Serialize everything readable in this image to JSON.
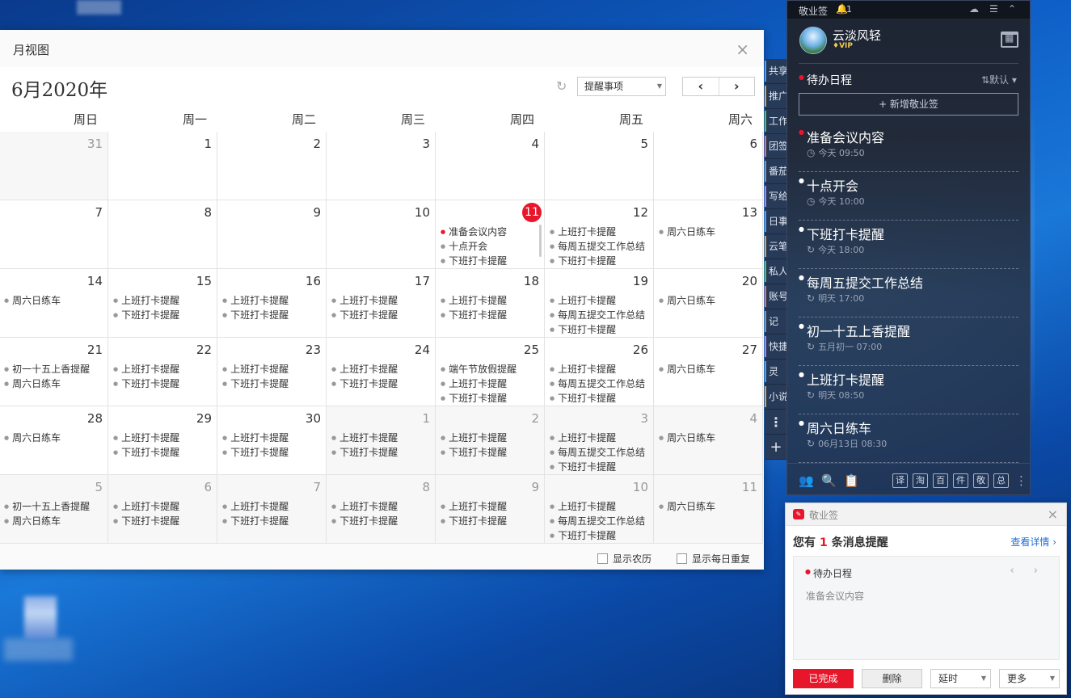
{
  "month_view": {
    "title": "月视图",
    "close_icon": "×",
    "month_label": "6月2020年",
    "refresh_icon": "↻",
    "filter_value": "提醒事项",
    "prev_icon": "‹",
    "next_icon": "›",
    "weekdays": [
      "周日",
      "周一",
      "周二",
      "周三",
      "周四",
      "周五",
      "周六"
    ],
    "weeks": [
      [
        {
          "day": "31",
          "other": true,
          "events": []
        },
        {
          "day": "1",
          "events": []
        },
        {
          "day": "2",
          "events": []
        },
        {
          "day": "3",
          "events": []
        },
        {
          "day": "4",
          "events": []
        },
        {
          "day": "5",
          "events": []
        },
        {
          "day": "6",
          "events": []
        }
      ],
      [
        {
          "day": "7",
          "events": []
        },
        {
          "day": "8",
          "events": []
        },
        {
          "day": "9",
          "events": []
        },
        {
          "day": "10",
          "events": []
        },
        {
          "day": "11",
          "today": true,
          "events": [
            "准备会议内容",
            "十点开会",
            "下班打卡提醒"
          ]
        },
        {
          "day": "12",
          "events": [
            "上班打卡提醒",
            "每周五提交工作总结",
            "下班打卡提醒"
          ]
        },
        {
          "day": "13",
          "events": [
            "周六日练车"
          ]
        }
      ],
      [
        {
          "day": "14",
          "events": [
            "周六日练车"
          ]
        },
        {
          "day": "15",
          "events": [
            "上班打卡提醒",
            "下班打卡提醒"
          ]
        },
        {
          "day": "16",
          "events": [
            "上班打卡提醒",
            "下班打卡提醒"
          ]
        },
        {
          "day": "17",
          "events": [
            "上班打卡提醒",
            "下班打卡提醒"
          ]
        },
        {
          "day": "18",
          "events": [
            "上班打卡提醒",
            "下班打卡提醒"
          ]
        },
        {
          "day": "19",
          "events": [
            "上班打卡提醒",
            "每周五提交工作总结",
            "下班打卡提醒"
          ]
        },
        {
          "day": "20",
          "events": [
            "周六日练车"
          ]
        }
      ],
      [
        {
          "day": "21",
          "events": [
            "初一十五上香提醒",
            "周六日练车"
          ]
        },
        {
          "day": "22",
          "events": [
            "上班打卡提醒",
            "下班打卡提醒"
          ]
        },
        {
          "day": "23",
          "events": [
            "上班打卡提醒",
            "下班打卡提醒"
          ]
        },
        {
          "day": "24",
          "events": [
            "上班打卡提醒",
            "下班打卡提醒"
          ]
        },
        {
          "day": "25",
          "events": [
            "端午节放假提醒",
            "上班打卡提醒",
            "下班打卡提醒"
          ]
        },
        {
          "day": "26",
          "events": [
            "上班打卡提醒",
            "每周五提交工作总结",
            "下班打卡提醒"
          ]
        },
        {
          "day": "27",
          "events": [
            "周六日练车"
          ]
        }
      ],
      [
        {
          "day": "28",
          "events": [
            "周六日练车"
          ]
        },
        {
          "day": "29",
          "events": [
            "上班打卡提醒",
            "下班打卡提醒"
          ]
        },
        {
          "day": "30",
          "events": [
            "上班打卡提醒",
            "下班打卡提醒"
          ]
        },
        {
          "day": "1",
          "other": true,
          "events": [
            "上班打卡提醒",
            "下班打卡提醒"
          ]
        },
        {
          "day": "2",
          "other": true,
          "events": [
            "上班打卡提醒",
            "下班打卡提醒"
          ]
        },
        {
          "day": "3",
          "other": true,
          "events": [
            "上班打卡提醒",
            "每周五提交工作总结",
            "下班打卡提醒"
          ]
        },
        {
          "day": "4",
          "other": true,
          "events": [
            "周六日练车"
          ]
        }
      ],
      [
        {
          "day": "5",
          "other": true,
          "events": [
            "初一十五上香提醒",
            "周六日练车"
          ]
        },
        {
          "day": "6",
          "other": true,
          "events": [
            "上班打卡提醒",
            "下班打卡提醒"
          ]
        },
        {
          "day": "7",
          "other": true,
          "events": [
            "上班打卡提醒",
            "下班打卡提醒"
          ]
        },
        {
          "day": "8",
          "other": true,
          "events": [
            "上班打卡提醒",
            "下班打卡提醒"
          ]
        },
        {
          "day": "9",
          "other": true,
          "events": [
            "上班打卡提醒",
            "下班打卡提醒"
          ]
        },
        {
          "day": "10",
          "other": true,
          "events": [
            "上班打卡提醒",
            "每周五提交工作总结",
            "下班打卡提醒"
          ]
        },
        {
          "day": "11",
          "other": true,
          "events": [
            "周六日练车"
          ]
        }
      ]
    ],
    "show_lunar_label": "显示农历",
    "show_daily_repeat_label": "显示每日重复"
  },
  "side_tabs": [
    "共享",
    "推广",
    "工作",
    "团签",
    "番茄",
    "写给",
    "日事",
    "云笔",
    "私人",
    "账号",
    "记",
    "快捷",
    "灵",
    "小说"
  ],
  "side_tabs_more": "⋮",
  "side_tabs_add": "+",
  "note_panel": {
    "app_name": "敬业签",
    "bell_icon": "🔔",
    "bell_count": "1",
    "cloud_icon": "☁",
    "menu_icon": "☰",
    "collapse_icon": "⌃",
    "username": "云淡风轻",
    "vip_label": "♦VIP",
    "category": "待办日程",
    "sort_label": "⇅默认 ▾",
    "add_label": "+ 新增敬业签",
    "items": [
      {
        "title": "准备会议内容",
        "time": "今天  09:50",
        "red": true,
        "repeat": false
      },
      {
        "title": "十点开会",
        "time": "今天  10:00",
        "red": false,
        "repeat": false
      },
      {
        "title": "下班打卡提醒",
        "time": "今天  18:00",
        "red": false,
        "repeat": true
      },
      {
        "title": "每周五提交工作总结",
        "time": "明天  17:00",
        "red": false,
        "repeat": true
      },
      {
        "title": "初一十五上香提醒",
        "time": "五月初一  07:00",
        "red": false,
        "repeat": true
      },
      {
        "title": "上班打卡提醒",
        "time": "明天  08:50",
        "red": false,
        "repeat": true
      },
      {
        "title": "周六日练车",
        "time": "06月13日  08:30",
        "red": false,
        "repeat": true
      }
    ],
    "bottom_icons": [
      "👥",
      "🔍",
      "📋"
    ],
    "bottom_tags": [
      "译",
      "淘",
      "百",
      "件",
      "敬",
      "总"
    ],
    "bottom_more": "⋮"
  },
  "reminder": {
    "app_name": "敬业签",
    "close_icon": "×",
    "msg_prefix": "您有",
    "msg_count": "1",
    "msg_suffix": "条消息提醒",
    "detail_link": "查看详情 ›",
    "category": "待办日程",
    "arrows": "‹ ›",
    "content": "准备会议内容",
    "done_label": "已完成",
    "delete_label": "删除",
    "delay_label": "延时",
    "more_label": "更多"
  },
  "colors": {
    "accent_red": "#e8162b",
    "link_blue": "#1e6fd9",
    "panel_dark": "#1d2432"
  }
}
